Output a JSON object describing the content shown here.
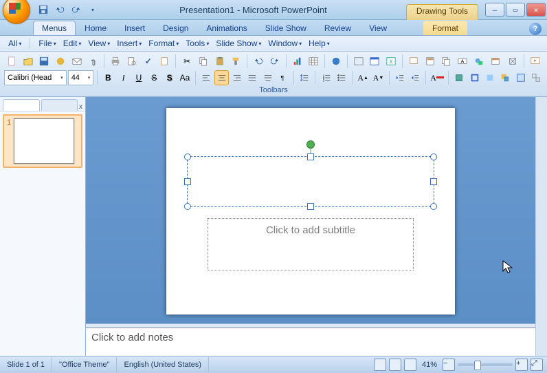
{
  "titlebar": {
    "title": "Presentation1 - Microsoft PowerPoint",
    "context_tool": "Drawing Tools",
    "win_min": "–",
    "win_max": "▭",
    "win_close": "✕"
  },
  "qat": {
    "items": [
      "save",
      "undo",
      "redo",
      "customize"
    ]
  },
  "tabs": {
    "items": [
      {
        "label": "Menus",
        "active": true
      },
      {
        "label": "Home"
      },
      {
        "label": "Insert"
      },
      {
        "label": "Design"
      },
      {
        "label": "Animations"
      },
      {
        "label": "Slide Show"
      },
      {
        "label": "Review"
      },
      {
        "label": "View"
      }
    ],
    "context_tab": {
      "label": "Format"
    }
  },
  "menus": {
    "items": [
      {
        "label": "All"
      },
      {
        "label": "File"
      },
      {
        "label": "Edit"
      },
      {
        "label": "View"
      },
      {
        "label": "Insert"
      },
      {
        "label": "Format"
      },
      {
        "label": "Tools"
      },
      {
        "label": "Slide Show"
      },
      {
        "label": "Window"
      },
      {
        "label": "Help"
      }
    ],
    "dropdown_arrow": "▾"
  },
  "toolbars": {
    "group_label": "Toolbars",
    "font_name": "Calibri (Head",
    "font_size": "44",
    "bold": "B",
    "italic": "I",
    "underline": "U",
    "strike": "S",
    "shadow": "S",
    "caseAa": "Aa"
  },
  "slidepanel": {
    "close": "x",
    "thumbs": [
      {
        "index": "1"
      }
    ]
  },
  "slide": {
    "title_placeholder": "",
    "subtitle_placeholder": "Click to add subtitle"
  },
  "notes": {
    "placeholder": "Click to add notes"
  },
  "status": {
    "slide": "Slide 1 of 1",
    "theme": "\"Office Theme\"",
    "language": "English (United States)",
    "zoom_label": "41%",
    "zoom_value": 41,
    "minus": "−",
    "plus": "+",
    "fit": "⤢"
  },
  "colors": {
    "ribbon_bg": "#e9f2fc",
    "accent": "#3a72b5",
    "selection": "#f4b26a"
  }
}
